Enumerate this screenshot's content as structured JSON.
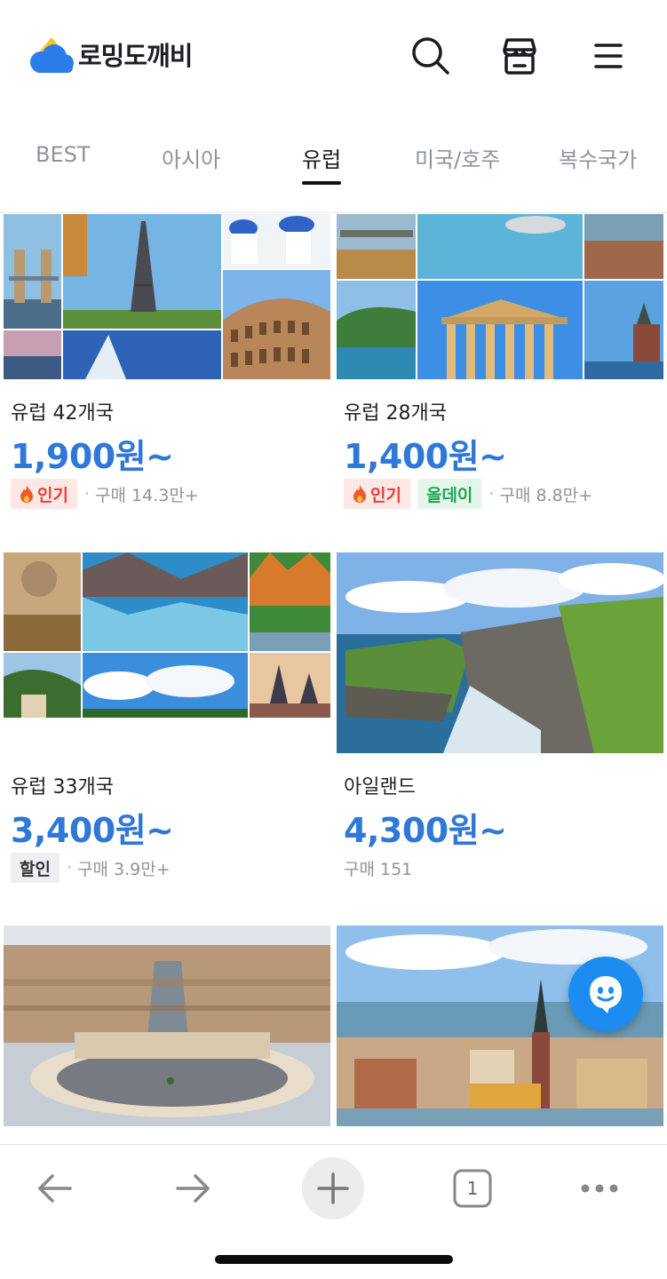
{
  "app": {
    "brand": "로밍도깨비",
    "icons": [
      "search-icon",
      "store-icon",
      "menu-icon"
    ]
  },
  "tabs": [
    {
      "label": "BEST",
      "active": false
    },
    {
      "label": "아시아",
      "active": false
    },
    {
      "label": "유럽",
      "active": true
    },
    {
      "label": "미국/호주",
      "active": false
    },
    {
      "label": "복수국가",
      "active": false
    }
  ],
  "products": [
    {
      "title": "유럽 42개국",
      "price": "1,900원~",
      "badges": [
        {
          "text": "인기",
          "type": "hot",
          "icon": "flame-icon"
        }
      ],
      "sales": "구매 14.3만+"
    },
    {
      "title": "유럽 28개국",
      "price": "1,400원~",
      "badges": [
        {
          "text": "인기",
          "type": "hot",
          "icon": "flame-icon"
        },
        {
          "text": "올데이",
          "type": "allday"
        }
      ],
      "sales": "구매 8.8만+"
    },
    {
      "title": "유럽 33개국",
      "price": "3,400원~",
      "badges": [
        {
          "text": "할인",
          "type": "sale"
        }
      ],
      "sales": "구매 3.9만+"
    },
    {
      "title": "아일랜드",
      "price": "4,300원~",
      "badges": [],
      "sales": "구매 151"
    }
  ],
  "browser": {
    "tab_count": "1",
    "icons": [
      "back-arrow-icon",
      "forward-arrow-icon",
      "new-tab-plus-icon",
      "tab-count-icon",
      "more-icon"
    ]
  },
  "colors": {
    "price": "#2f78d7",
    "hot_badge_bg": "#fde8e6",
    "hot_badge_text": "#e8403a",
    "allday_badge_bg": "#e4f6ea",
    "allday_badge_text": "#1da55a",
    "chat_fab": "#1c8cf0",
    "logo_yellow": "#f7c325",
    "logo_blue": "#2b7de9"
  }
}
